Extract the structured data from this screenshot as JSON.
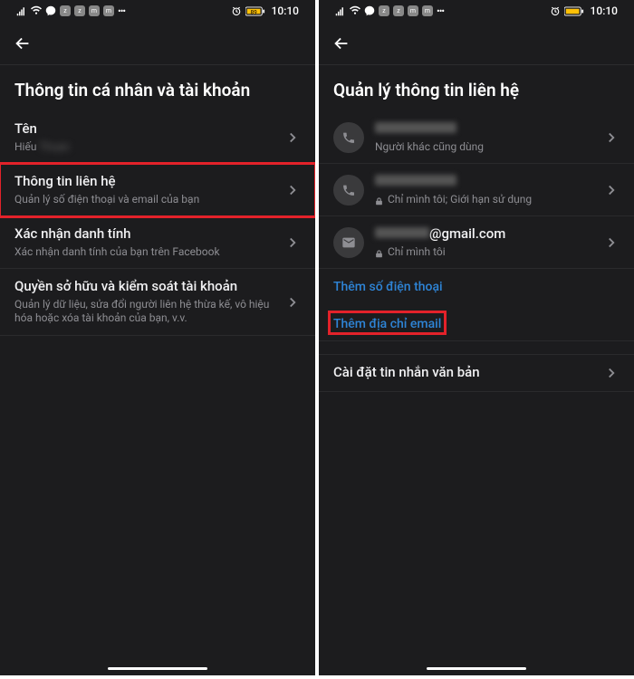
{
  "status": {
    "time": "10:10",
    "alarm_icon": "alarm",
    "battery_text": "89"
  },
  "left_screen": {
    "title": "Thông tin cá nhân và tài khoản",
    "items": [
      {
        "label": "Tên",
        "sub": "Hiếu"
      },
      {
        "label": "Thông tin liên hệ",
        "sub": "Quản lý số điện thoại và email của bạn"
      },
      {
        "label": "Xác nhận danh tính",
        "sub": "Xác nhận danh tính của bạn trên Facebook"
      },
      {
        "label": "Quyền sở hữu và kiểm soát tài khoản",
        "sub": "Quản lý dữ liệu, sửa đổi người liên hệ thừa kế, vô hiệu hóa hoặc xóa tài khoản của bạn, v.v."
      }
    ]
  },
  "right_screen": {
    "title": "Quản lý thông tin liên hệ",
    "contacts": [
      {
        "sub": "Người khác cũng dùng",
        "type": "phone"
      },
      {
        "sub": "Chỉ mình tôi; Giới hạn sử dụng",
        "type": "phone",
        "locked": true
      },
      {
        "value_suffix": "@gmail.com",
        "sub": "Chỉ mình tôi",
        "type": "email",
        "locked": true
      }
    ],
    "add_phone": "Thêm số điện thoại",
    "add_email": "Thêm địa chỉ email",
    "sms_settings": "Cài đặt tin nhắn văn bản"
  }
}
